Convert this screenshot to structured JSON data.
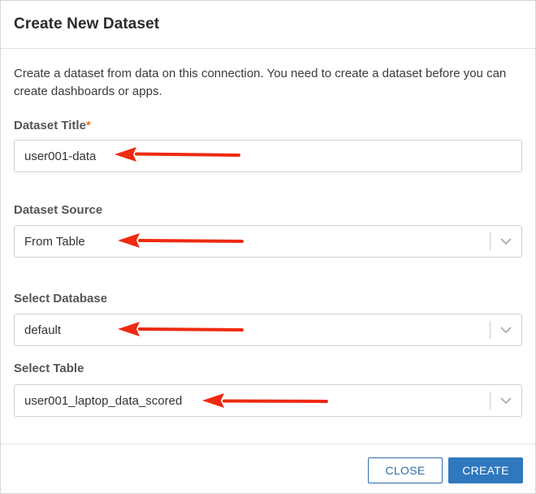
{
  "dialog": {
    "title": "Create New Dataset",
    "description": "Create a dataset from data on this connection. You need to create a dataset before you can create dashboards or apps."
  },
  "fields": {
    "title": {
      "label": "Dataset Title",
      "required_mark": "*",
      "value": "user001-data"
    },
    "source": {
      "label": "Dataset Source",
      "value": "From Table"
    },
    "database": {
      "label": "Select Database",
      "value": "default"
    },
    "table": {
      "label": "Select Table",
      "value": "user001_laptop_data_scored"
    }
  },
  "buttons": {
    "close": "CLOSE",
    "create": "CREATE"
  },
  "colors": {
    "accent": "#2f78bd",
    "required": "#e8731a",
    "annotation_arrow": "#ee2a10"
  },
  "icons": {
    "select": "chevron-down-icon",
    "annotation": "red-arrow-icon"
  }
}
